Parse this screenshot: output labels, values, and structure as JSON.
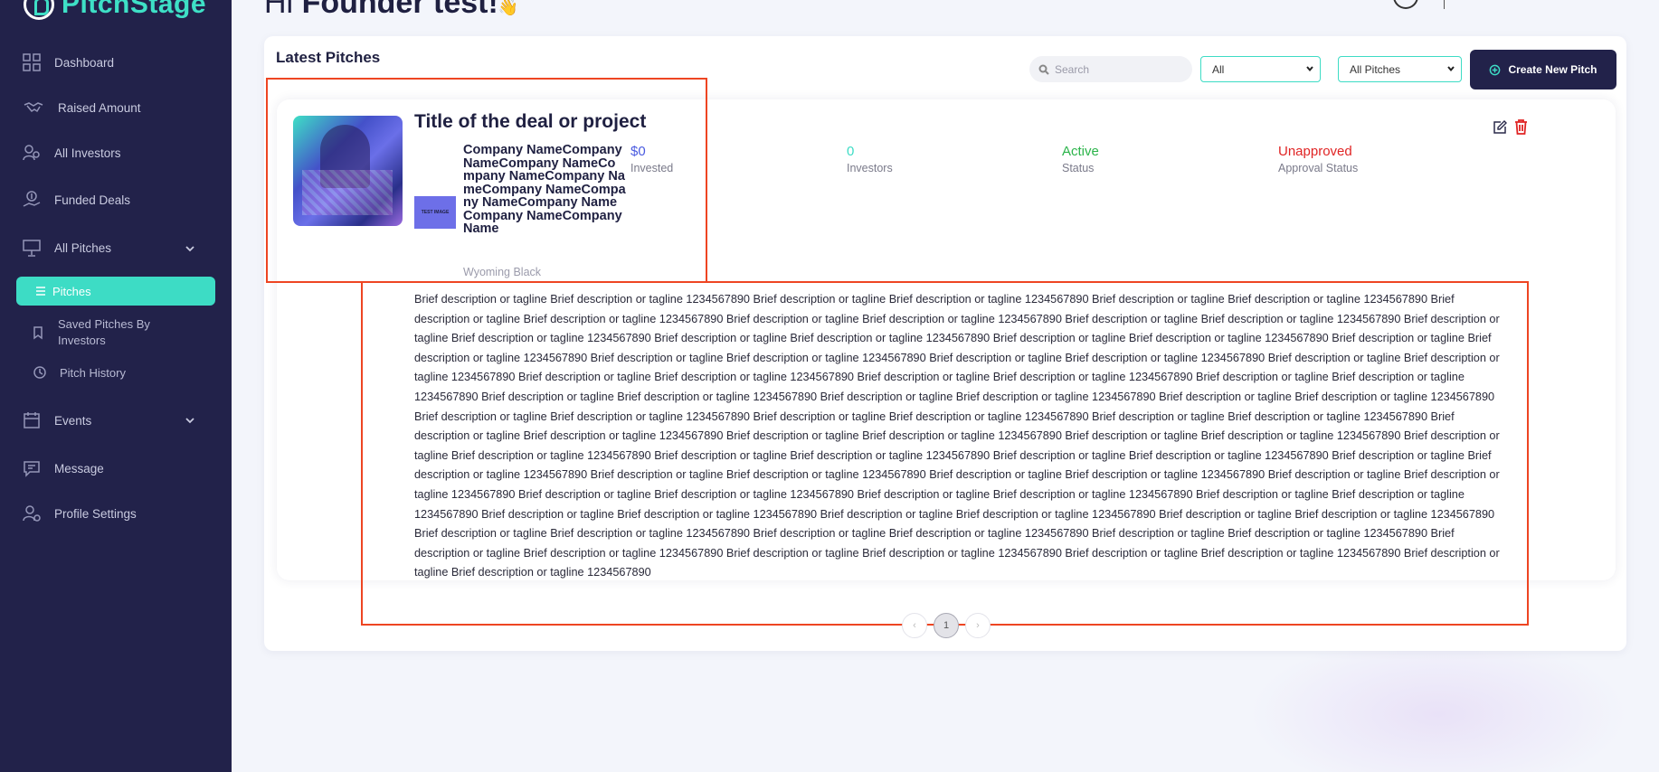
{
  "brand": {
    "name": "PitchStage"
  },
  "header": {
    "greeting_prefix": "Hi ",
    "greeting_name": "Founder test!",
    "wave": "👋"
  },
  "sidebar": {
    "items": [
      {
        "label": "Dashboard"
      },
      {
        "label": "Raised Amount"
      },
      {
        "label": "All Investors"
      },
      {
        "label": "Funded Deals"
      },
      {
        "label": "All Pitches"
      },
      {
        "label": "Pitches"
      },
      {
        "label": "Saved Pitches By Investors"
      },
      {
        "label": "Pitch History"
      },
      {
        "label": "Events"
      },
      {
        "label": "Message"
      },
      {
        "label": "Profile Settings"
      }
    ]
  },
  "main": {
    "title": "Latest Pitches",
    "search": {
      "placeholder": "Search",
      "value": ""
    },
    "filter1": {
      "selected": "All"
    },
    "filter2": {
      "selected": "All Pitches"
    },
    "create_label": "Create New Pitch"
  },
  "pitch": {
    "title": "Title of the deal or project",
    "company_logo_text": "TEST IMAGE",
    "company_name": "Company NameCompany NameCompany NameCompany NameCompany NameCompany NameCompany NameCompany NameCompany NameCompany Name",
    "location": "Wyoming Black",
    "invested": {
      "value": "$0",
      "label": "Invested",
      "color": "#4a5be0"
    },
    "investors": {
      "value": "0",
      "label": "Investors",
      "color": "#3ddcc5"
    },
    "status": {
      "value": "Active",
      "label": "Status",
      "color": "#2bb44a"
    },
    "approval": {
      "value": "Unapproved",
      "label": "Approval Status",
      "color": "#e02424"
    },
    "description": "Brief description or tagline Brief description or tagline 1234567890 Brief description or tagline Brief description or tagline 1234567890 Brief description or tagline Brief description or tagline 1234567890 Brief description or tagline Brief description or tagline 1234567890 Brief description or tagline Brief description or tagline 1234567890 Brief description or tagline Brief description or tagline 1234567890 Brief description or tagline Brief description or tagline 1234567890 Brief description or tagline Brief description or tagline 1234567890 Brief description or tagline Brief description or tagline 1234567890 Brief description or tagline Brief description or tagline 1234567890 Brief description or tagline Brief description or tagline 1234567890 Brief description or tagline Brief description or tagline 1234567890 Brief description or tagline Brief description or tagline 1234567890 Brief description or tagline Brief description or tagline 1234567890 Brief description or tagline Brief description or tagline 1234567890 Brief description or tagline Brief description or tagline 1234567890 Brief description or tagline Brief description or tagline 1234567890 Brief description or tagline Brief description or tagline 1234567890 Brief description or tagline Brief description or tagline 1234567890 Brief description or tagline Brief description or tagline 1234567890 Brief description or tagline Brief description or tagline 1234567890 Brief description or tagline Brief description or tagline 1234567890 Brief description or tagline Brief description or tagline 1234567890 Brief description or tagline Brief description or tagline 1234567890 Brief description or tagline Brief description or tagline 1234567890 Brief description or tagline Brief description or tagline 1234567890 Brief description or tagline Brief description or tagline 1234567890 Brief description or tagline Brief description or tagline 1234567890 Brief description or tagline Brief description or tagline 1234567890 Brief description or tagline Brief description or tagline 1234567890 Brief description or tagline Brief description or tagline 1234567890 Brief description or tagline Brief description or tagline 1234567890 Brief description or tagline Brief description or tagline 1234567890 Brief description or tagline Brief description or tagline 1234567890 Brief description or tagline Brief description or tagline 1234567890 Brief description or tagline Brief description or tagline 1234567890 Brief description or tagline Brief description or tagline 1234567890 Brief description or tagline Brief description or tagline 1234567890 Brief description or tagline Brief description or tagline 1234567890 Brief description or tagline Brief description or tagline 1234567890 Brief description or tagline Brief description or tagline 1234567890 Brief description or tagline Brief description or tagline 1234567890 Brief description or tagline Brief description or tagline 1234567890 Brief description or tagline Brief description or tagline 1234567890 Brief description or tagline Brief description or tagline 1234567890"
  },
  "pagination": {
    "prev": "‹",
    "current": "1",
    "next": "›"
  },
  "colors": {
    "sidebar": "#22224a",
    "accent": "#3ddcc5",
    "annotation": "#ee4522"
  }
}
